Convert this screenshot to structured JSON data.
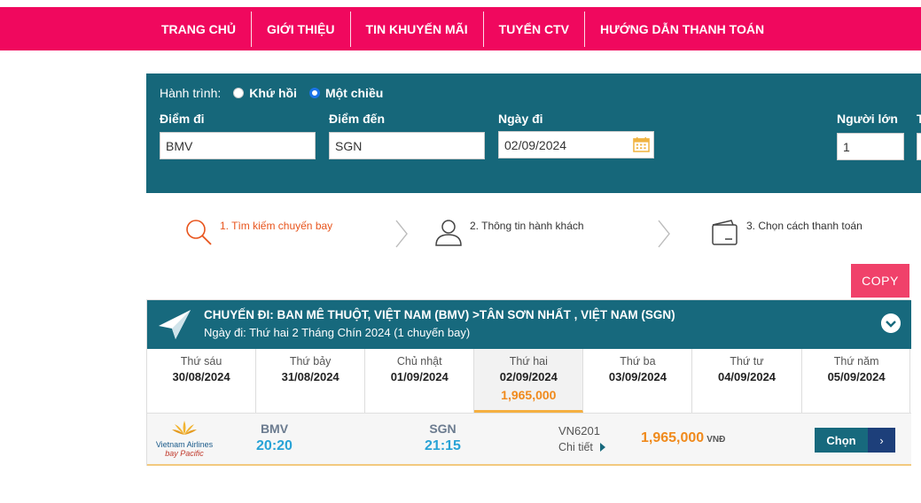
{
  "nav": {
    "items": [
      "TRANG CHỦ",
      "GIỚI THIỆU",
      "TIN KHUYẾN MÃI",
      "TUYỂN CTV",
      "HƯỚNG DẪN THANH TOÁN"
    ]
  },
  "search": {
    "trip_label": "Hành trình:",
    "round_trip": "Khứ hồi",
    "one_way": "Một chiều",
    "selected_trip": "one_way",
    "from_label": "Điểm đi",
    "from_value": "BMV",
    "to_label": "Điểm đến",
    "to_value": "SGN",
    "date_label": "Ngày đi",
    "date_value": "02/09/2024",
    "adults_label": "Người lớn",
    "adults_value": "1",
    "next_label_partial": "T"
  },
  "steps": [
    {
      "label": "1. Tìm kiếm chuyến bay",
      "icon": "search-icon",
      "active": true
    },
    {
      "label": "2. Thông tin hành khách",
      "icon": "user-icon",
      "active": false
    },
    {
      "label": "3. Chọn cách thanh toán",
      "icon": "wallet-icon",
      "active": false
    }
  ],
  "copy_label": "COPY",
  "flight": {
    "route": "CHUYẾN ĐI: BAN MÊ THUỘT, VIỆT NAM (BMV) >TÂN SƠN NHẤT , VIỆT NAM (SGN)",
    "subtitle": "Ngày đi: Thứ hai 2 Tháng Chín 2024 (1 chuyến bay)",
    "dates": [
      {
        "dow": "Thứ sáu",
        "date": "30/08/2024",
        "price": ""
      },
      {
        "dow": "Thứ bảy",
        "date": "31/08/2024",
        "price": ""
      },
      {
        "dow": "Chủ nhật",
        "date": "01/09/2024",
        "price": ""
      },
      {
        "dow": "Thứ hai",
        "date": "02/09/2024",
        "price": "1,965,000",
        "active": true
      },
      {
        "dow": "Thứ ba",
        "date": "03/09/2024",
        "price": ""
      },
      {
        "dow": "Thứ tư",
        "date": "04/09/2024",
        "price": ""
      },
      {
        "dow": "Thứ năm",
        "date": "05/09/2024",
        "price": ""
      }
    ],
    "result": {
      "airline_logo_text": "Vietnam Airlines",
      "airline_sub": "bay Pacific",
      "from_code": "BMV",
      "from_time": "20:20",
      "to_code": "SGN",
      "to_time": "21:15",
      "flight_no": "VN6201",
      "detail_label": "Chi tiết",
      "price": "1,965,000",
      "currency": "VNĐ",
      "select_label": "Chọn",
      "select_arrow": "›"
    }
  },
  "colors": {
    "nav_bg": "#f0085e",
    "panel_bg": "#16677a",
    "accent_orange": "#f08a1c",
    "copy_bg": "#f0416a"
  }
}
